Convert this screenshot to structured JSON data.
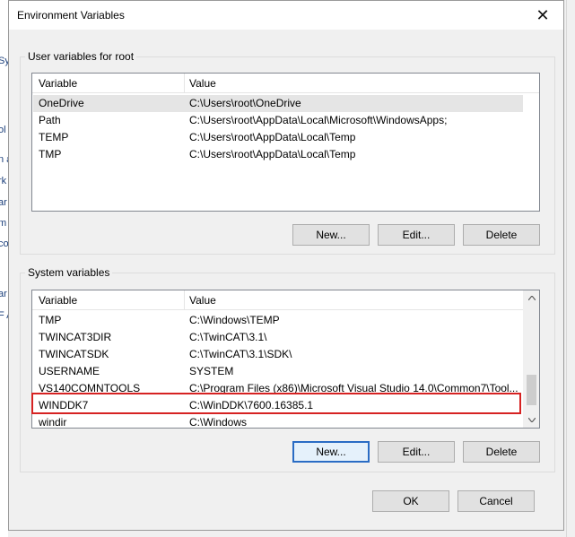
{
  "background_fragments": [
    "Sy",
    "ol",
    "n a",
    "rk",
    "ar",
    "m",
    "co",
    "ar",
    "F A"
  ],
  "dialog": {
    "title": "Environment Variables",
    "close_glyph": "✕"
  },
  "user_vars": {
    "group_title": "User variables for root",
    "columns": [
      "Variable",
      "Value"
    ],
    "rows": [
      {
        "variable": "OneDrive",
        "value": "C:\\Users\\root\\OneDrive"
      },
      {
        "variable": "Path",
        "value": "C:\\Users\\root\\AppData\\Local\\Microsoft\\WindowsApps;"
      },
      {
        "variable": "TEMP",
        "value": "C:\\Users\\root\\AppData\\Local\\Temp"
      },
      {
        "variable": "TMP",
        "value": "C:\\Users\\root\\AppData\\Local\\Temp"
      }
    ],
    "buttons": {
      "new": "New...",
      "edit": "Edit...",
      "delete": "Delete"
    }
  },
  "system_vars": {
    "group_title": "System variables",
    "columns": [
      "Variable",
      "Value"
    ],
    "rows": [
      {
        "variable": "TMP",
        "value": "C:\\Windows\\TEMP"
      },
      {
        "variable": "TWINCAT3DIR",
        "value": "C:\\TwinCAT\\3.1\\"
      },
      {
        "variable": "TWINCATSDK",
        "value": "C:\\TwinCAT\\3.1\\SDK\\"
      },
      {
        "variable": "USERNAME",
        "value": "SYSTEM"
      },
      {
        "variable": "VS140COMNTOOLS",
        "value": "C:\\Program Files (x86)\\Microsoft Visual Studio 14.0\\Common7\\Tool..."
      },
      {
        "variable": "WINDDK7",
        "value": "C:\\WinDDK\\7600.16385.1"
      },
      {
        "variable": "windir",
        "value": "C:\\Windows"
      }
    ],
    "buttons": {
      "new": "New...",
      "edit": "Edit...",
      "delete": "Delete"
    }
  },
  "footer": {
    "ok": "OK",
    "cancel": "Cancel"
  },
  "colors": {
    "highlight": "#d62222",
    "selection": "#e5e5e5",
    "default_button_border": "#2a6cc4"
  }
}
